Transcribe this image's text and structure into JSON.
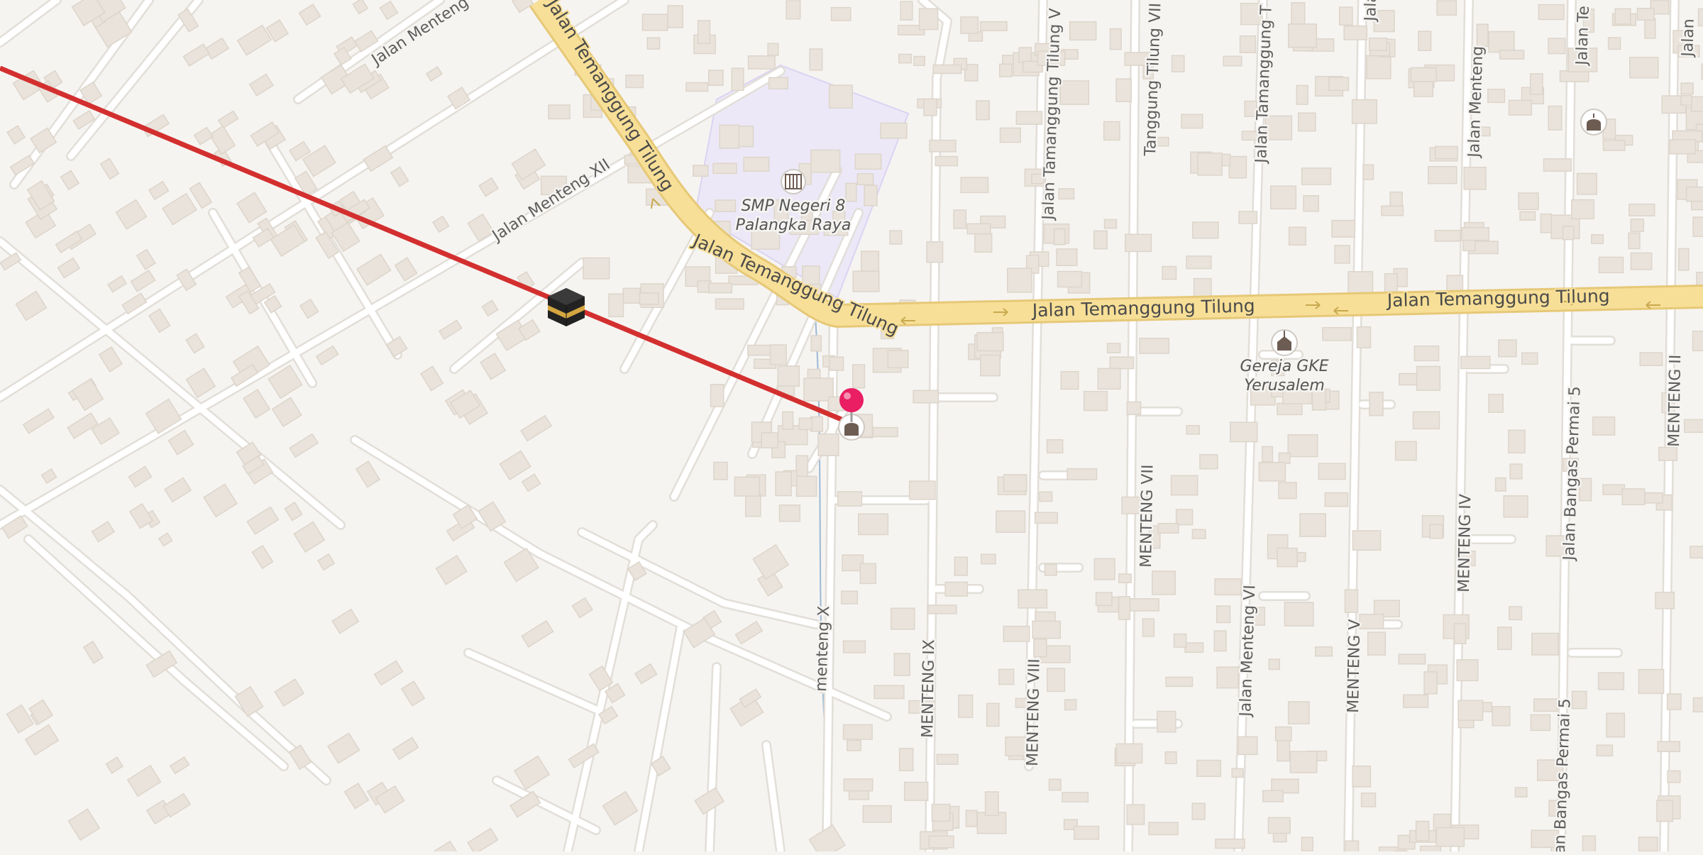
{
  "map": {
    "roads": {
      "main_road": "Jalan Temanggung Tilung",
      "main_road_left_fragment": "Jalan Temanggung Tilung",
      "jalan_menteng_top": "Jalan Menteng",
      "jalan_menteng_xii": "Jalan Menteng XII",
      "menteng_x": "menteng X",
      "menteng_ix": "MENTENG IX",
      "menteng_viii": "MENTENG VIII",
      "menteng_vii": "MENTENG VII",
      "menteng_vi": "Jalan Menteng VI",
      "menteng_v": "MENTENG V",
      "menteng_iv": "MENTENG IV",
      "menteng_ii": "MENTENG II",
      "tamanggung_tilung_top1": "Jalan Tamanggung Tilung V",
      "tamanggung_tilung_top2": "Jalan Tamanggung T",
      "tanggung_tilung_vii": "Tanggung Tilung VII",
      "jalan_ta_top": "Jalan Ta",
      "jalan_menteng_top_right": "Jalan Menteng",
      "jalan_te_top": "Jalan Te",
      "bangas_permai_5": "Jalan Bangas Permai 5",
      "bangas_permai_5_bottom": "Jalan Bangas Permai 5",
      "jalan_right_edge": "Jalan"
    },
    "pois": {
      "school_name_line1": "SMP Negeri 8",
      "school_name_line2": "Palangka Raya",
      "school_icon": "school-icon",
      "church_name_line1": "Gereja GKE",
      "church_name_line2": "Yerusalem",
      "church_icon": "church-icon",
      "mosque_icon": "mosque-icon",
      "kaaba_icon": "kaaba-icon",
      "location_pin_icon": "location-pin-icon"
    },
    "colors": {
      "background": "#f6f4f1",
      "main_road": "#f7df97",
      "qibla_line": "#d32f2f",
      "pin": "#e91e63",
      "school_area": "#ece8f7",
      "stream": "#9bb9d6"
    }
  }
}
